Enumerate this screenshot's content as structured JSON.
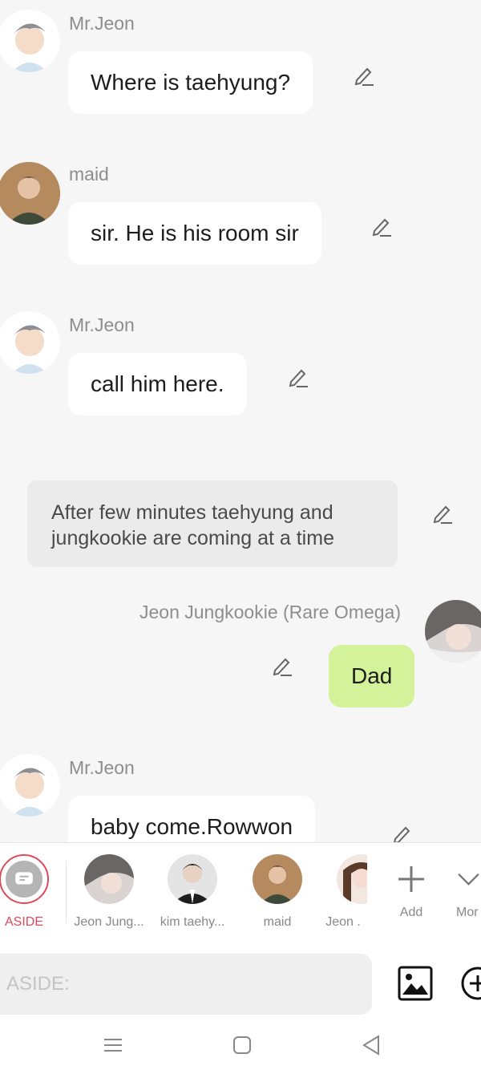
{
  "messages": [
    {
      "speaker": "Mr.Jeon",
      "text": "Where is taehyung?"
    },
    {
      "speaker": "maid",
      "text": "sir. He is his room sir"
    },
    {
      "speaker": "Mr.Jeon",
      "text": "call him here."
    },
    {
      "aside": "After few minutes taehyung and jungkookie are coming at a time"
    },
    {
      "speaker": "Jeon Jungkookie (Rare Omega)",
      "text": "Dad"
    },
    {
      "speaker": "Mr.Jeon",
      "text": "baby come.Rowwon"
    }
  ],
  "characters": [
    {
      "label": "ASIDE"
    },
    {
      "label": "Jeon Jung..."
    },
    {
      "label": "kim taehy..."
    },
    {
      "label": "maid"
    },
    {
      "label": "Jeon ."
    },
    {
      "label": "Add"
    },
    {
      "label": "Mor"
    }
  ],
  "input": {
    "placeholder": "ASIDE:"
  },
  "colors": {
    "my_bubble": "#d4f29a",
    "aside_accent": "#e0495a"
  }
}
